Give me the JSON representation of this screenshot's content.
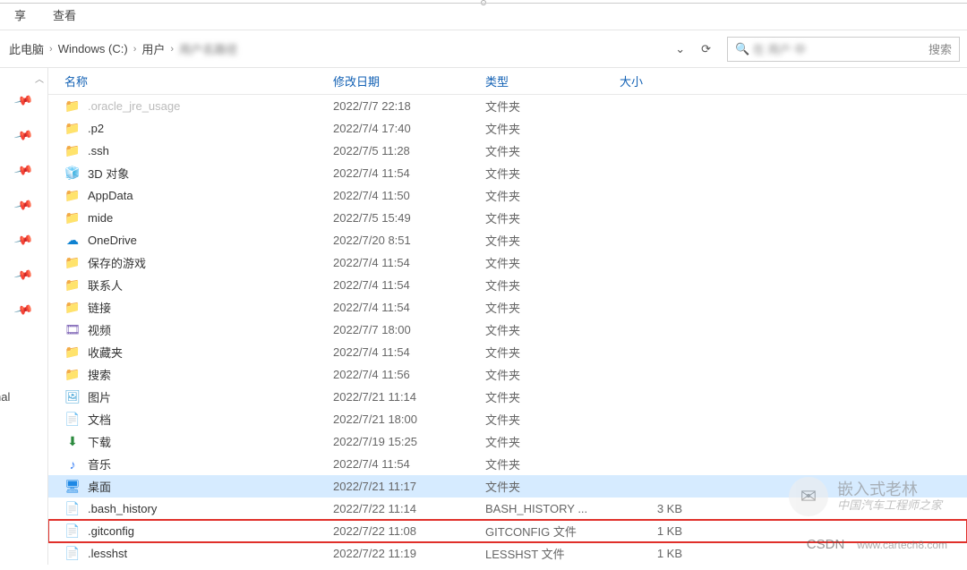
{
  "menubar": {
    "item_left_fragment": "享",
    "view_label": "查看"
  },
  "breadcrumb": {
    "seg0": "此电脑",
    "seg1": "Windows (C:)",
    "seg2": "用户",
    "seg3_blurred": "用户名路径"
  },
  "search": {
    "icon_char": "🔍",
    "blurred_prefix": "在 用户 中",
    "suffix": "搜索"
  },
  "addr_controls": {
    "dropdown_char": "⌄",
    "refresh_char": "⟳"
  },
  "nav_scroll_hint": "︿",
  "tree_label_partial": "nal",
  "columns": {
    "name": "名称",
    "date": "修改日期",
    "type": "类型",
    "size": "大小"
  },
  "size_label_kb": "KB",
  "files": [
    {
      "name": ".oracle_jre_usage",
      "date": "2022/7/7 22:18",
      "type": "文件夹",
      "size": "",
      "icon": "folder",
      "dimtop": true
    },
    {
      "name": ".p2",
      "date": "2022/7/4 17:40",
      "type": "文件夹",
      "size": "",
      "icon": "folder"
    },
    {
      "name": ".ssh",
      "date": "2022/7/5 11:28",
      "type": "文件夹",
      "size": "",
      "icon": "folder"
    },
    {
      "name": "3D 对象",
      "date": "2022/7/4 11:54",
      "type": "文件夹",
      "size": "",
      "icon": "3d"
    },
    {
      "name": "AppData",
      "date": "2022/7/4 11:50",
      "type": "文件夹",
      "size": "",
      "icon": "folder"
    },
    {
      "name": "mide",
      "date": "2022/7/5 15:49",
      "type": "文件夹",
      "size": "",
      "icon": "folder"
    },
    {
      "name": "OneDrive",
      "date": "2022/7/20 8:51",
      "type": "文件夹",
      "size": "",
      "icon": "cloud"
    },
    {
      "name": "保存的游戏",
      "date": "2022/7/4 11:54",
      "type": "文件夹",
      "size": "",
      "icon": "folder"
    },
    {
      "name": "联系人",
      "date": "2022/7/4 11:54",
      "type": "文件夹",
      "size": "",
      "icon": "folder"
    },
    {
      "name": "链接",
      "date": "2022/7/4 11:54",
      "type": "文件夹",
      "size": "",
      "icon": "folder"
    },
    {
      "name": "视频",
      "date": "2022/7/7 18:00",
      "type": "文件夹",
      "size": "",
      "icon": "video"
    },
    {
      "name": "收藏夹",
      "date": "2022/7/4 11:54",
      "type": "文件夹",
      "size": "",
      "icon": "folder"
    },
    {
      "name": "搜索",
      "date": "2022/7/4 11:56",
      "type": "文件夹",
      "size": "",
      "icon": "folder-blue"
    },
    {
      "name": "图片",
      "date": "2022/7/21 11:14",
      "type": "文件夹",
      "size": "",
      "icon": "img"
    },
    {
      "name": "文档",
      "date": "2022/7/21 18:00",
      "type": "文件夹",
      "size": "",
      "icon": "doc"
    },
    {
      "name": "下载",
      "date": "2022/7/19 15:25",
      "type": "文件夹",
      "size": "",
      "icon": "arrow"
    },
    {
      "name": "音乐",
      "date": "2022/7/4 11:54",
      "type": "文件夹",
      "size": "",
      "icon": "music"
    },
    {
      "name": "桌面",
      "date": "2022/7/21 11:17",
      "type": "文件夹",
      "size": "",
      "icon": "desk",
      "selected": true
    },
    {
      "name": ".bash_history",
      "date": "2022/7/22 11:14",
      "type": "BASH_HISTORY ...",
      "size": "3 KB",
      "icon": "file"
    },
    {
      "name": ".gitconfig",
      "date": "2022/7/22 11:08",
      "type": "GITCONFIG 文件",
      "size": "1 KB",
      "icon": "file",
      "highlight": true
    },
    {
      "name": ".lesshst",
      "date": "2022/7/22 11:19",
      "type": "LESSHST 文件",
      "size": "1 KB",
      "icon": "file"
    }
  ],
  "watermarks": {
    "wm1_title": "嵌入式老林",
    "wm1_sub_a": "中国汽车工程师之家",
    "wm2_left": "CSDN",
    "wm2_right": "www.cartech8.com"
  }
}
